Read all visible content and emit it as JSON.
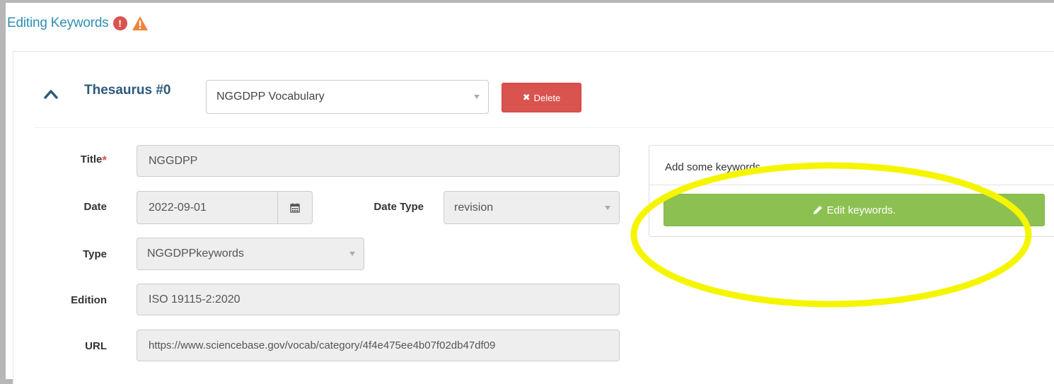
{
  "header": {
    "title": "Editing Keywords",
    "error_icon": "exclamation-circle-icon",
    "warning_icon": "warning-triangle-icon"
  },
  "thesaurus": {
    "label": "Thesaurus #0",
    "vocabulary_selected": "NGGDPP Vocabulary",
    "delete_label": "Delete",
    "collapse_icon": "chevron-up-icon"
  },
  "form": {
    "title_label": "Title",
    "title_required_mark": "*",
    "title_value": "NGGDPP",
    "date_label": "Date",
    "date_value": "2022-09-01",
    "date_type_label": "Date Type",
    "date_type_value": "revision",
    "type_label": "Type",
    "type_value": "NGGDPPkeywords",
    "edition_label": "Edition",
    "edition_value": "ISO 19115-2:2020",
    "url_label": "URL",
    "url_value": "https://www.sciencebase.gov/vocab/category/4f4e475ee4b07f02db47df09"
  },
  "keywords": {
    "hint": "Add some keywords.",
    "edit_label": "Edit keywords."
  },
  "colors": {
    "title_blue": "#2f8fb4",
    "danger": "#d9534f",
    "warning": "#f0843c",
    "success": "#8cc152",
    "highlight": "#f5f500"
  }
}
